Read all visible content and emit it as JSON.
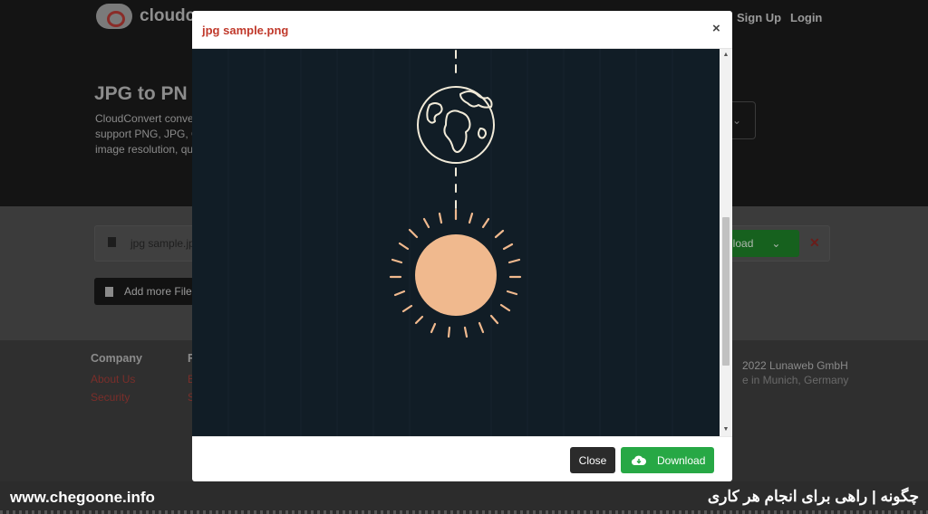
{
  "background": {
    "logo_text": "cloudc",
    "nav": {
      "sign_up": "Sign Up",
      "login": "Login"
    },
    "hero": {
      "title": "JPG to PN",
      "desc_lines": [
        "CloudConvert conver",
        "support PNG, JPG, GI",
        "image resolution, qu"
      ]
    },
    "file_row": {
      "file_name": "jpg sample.jp",
      "download_label": "nload",
      "remove_icon": "close-icon"
    },
    "add_files_label": "Add more File",
    "footer": {
      "company_heading": "Company",
      "about_label": "About Us",
      "security_label": "Security",
      "col2_heading": "R",
      "col2_item1": "B",
      "col2_item2": "S",
      "copyright": "2022 Lunaweb GmbH",
      "location": "e in Munich, Germany"
    }
  },
  "modal": {
    "title": "jpg sample.png",
    "close_icon": "close-icon",
    "close_button": "Close",
    "download_button": "Download",
    "download_icon": "cloud-download-icon",
    "preview_colors": {
      "background": "#111d26",
      "sun": "#f0b98e",
      "line": "#f1ead8"
    }
  },
  "watermark": {
    "left": "www.chegoone.info",
    "right": "چگونه | راهی برای انجام هر کاری"
  }
}
